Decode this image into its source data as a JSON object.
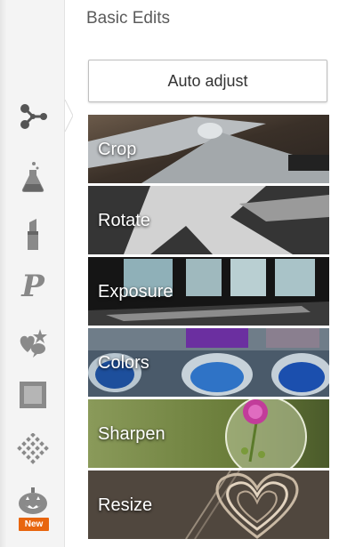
{
  "panel": {
    "title": "Basic Edits",
    "auto_adjust_label": "Auto adjust"
  },
  "tools": [
    {
      "label": "Crop"
    },
    {
      "label": "Rotate"
    },
    {
      "label": "Exposure"
    },
    {
      "label": "Colors"
    },
    {
      "label": "Sharpen"
    },
    {
      "label": "Resize"
    }
  ],
  "sidebar": {
    "icons": [
      "basic-edits-icon",
      "effects-flask-icon",
      "touch-up-lipstick-icon",
      "text-p-icon",
      "stickers-heart-icon",
      "frames-icon",
      "textures-icon",
      "seasonal-pumpkin-icon"
    ],
    "new_badge": "New"
  },
  "colors": {
    "accent": "#e8650e",
    "icon_gray": "#7a7a7a"
  }
}
